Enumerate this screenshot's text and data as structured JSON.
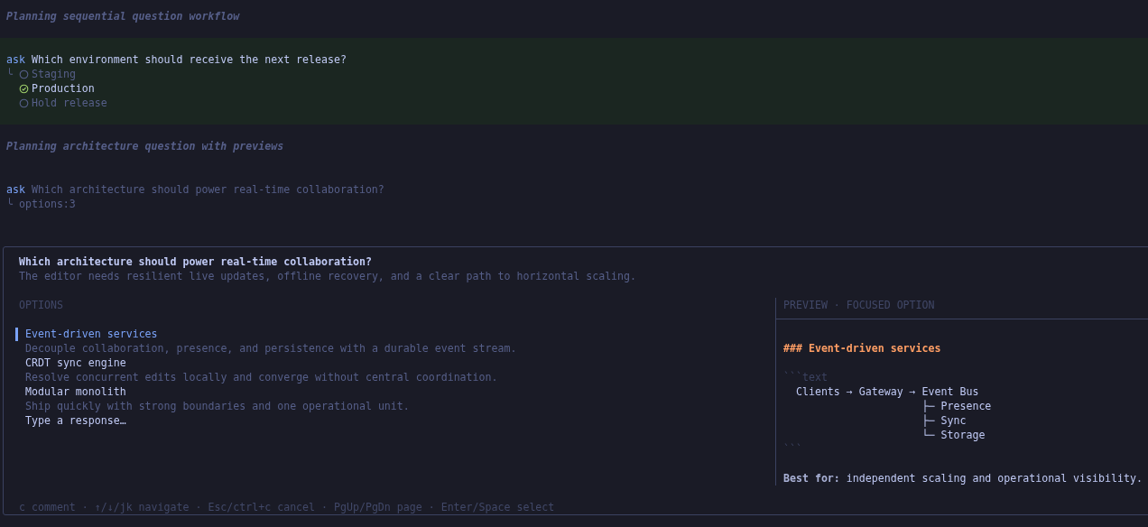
{
  "log": [
    {
      "kind": "heading",
      "text": "Planning sequential question workflow"
    },
    {
      "kind": "answered",
      "tool": "ask",
      "question": "Which environment should receive the next release?",
      "branch": "╰",
      "options": [
        {
          "label": "Staging",
          "selected": false
        },
        {
          "label": "Production",
          "selected": true
        },
        {
          "label": "Hold release",
          "selected": false
        }
      ]
    },
    {
      "kind": "heading",
      "text": "Planning architecture question with previews"
    },
    {
      "kind": "pending",
      "tool": "ask",
      "question": "Which architecture should power real-time collaboration?",
      "branch": "╰",
      "summary": "options:3"
    }
  ],
  "panel": {
    "question": "Which architecture should power real-time collaboration?",
    "description": "The editor needs resilient live updates, offline recovery, and a clear path to horizontal scaling.",
    "options_label": "OPTIONS",
    "options": [
      {
        "label": "Event-driven services",
        "description": "Decouple collaboration, presence, and persistence with a durable event stream.",
        "selected": true
      },
      {
        "label": "CRDT sync engine",
        "description": "Resolve concurrent edits locally and converge without central coordination.",
        "selected": false
      },
      {
        "label": "Modular monolith",
        "description": "Ship quickly with strong boundaries and one operational unit.",
        "selected": false
      }
    ],
    "custom_placeholder": "Type a response…",
    "preview_label": "PREVIEW · FOCUSED OPTION",
    "preview": [
      {
        "kind": "heading",
        "text": "### Event-driven services"
      },
      {
        "kind": "blank"
      },
      {
        "kind": "fence",
        "text": "```text"
      },
      {
        "kind": "code",
        "text": "  Clients → Gateway → Event Bus"
      },
      {
        "kind": "code",
        "text": "                      ├─ Presence"
      },
      {
        "kind": "code",
        "text": "                      ├─ Sync"
      },
      {
        "kind": "code",
        "text": "                      └─ Storage"
      },
      {
        "kind": "fence",
        "text": "```"
      },
      {
        "kind": "blank"
      },
      {
        "kind": "text",
        "text": "**Best for:** independent scaling and operational visibility."
      }
    ],
    "footer": "c comment · ↑/↓/jk navigate · Esc/ctrl+c cancel · PgUp/PgDn page · Enter/Space select"
  }
}
